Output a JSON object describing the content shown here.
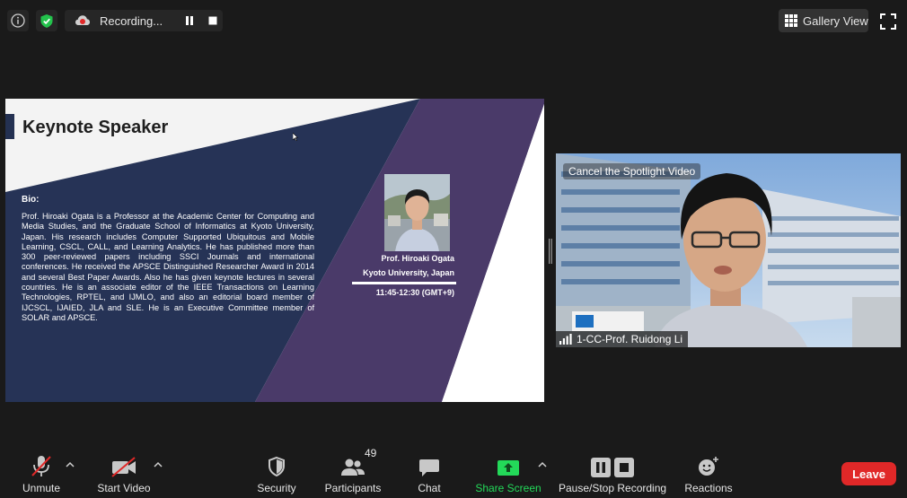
{
  "top_bar": {
    "info_icon": "info-icon",
    "security_icon": "shield-check-icon",
    "recording_label": "Recording...",
    "gallery_label": "Gallery View"
  },
  "slide": {
    "title": "Keynote Speaker",
    "bio_label": "Bio:",
    "bio_text": "Prof. Hiroaki Ogata is a Professor at the Academic Center for Computing and Media Studies, and the Graduate School of Informatics at Kyoto University, Japan. His research includes Computer Supported Ubiquitous and Mobile Learning, CSCL, CALL, and Learning Analytics. He has published more than 300 peer-reviewed papers including SSCI Journals and international conferences. He received the APSCE Distinguished Researcher Award in 2014 and several Best Paper Awards. Also he has given keynote lectures in several countries. He is an associate editor of the IEEE Transactions on Learning Technologies, RPTEL, and IJMLO, and also an editorial board member of IJCSCL, IJAIED, JLA and SLE. He is an Executive Committee member of SOLAR and APSCE.",
    "speaker_name": "Prof. Hiroaki Ogata",
    "speaker_affiliation": "Kyoto University, Japan",
    "session_time": "11:45-12:30 (GMT+9)",
    "colors": {
      "navy": "#243152",
      "purple": "#4b3a68",
      "background": "#f2f2f2"
    }
  },
  "video": {
    "cancel_spotlight_label": "Cancel the Spotlight Video",
    "participant_name": "1-CC-Prof. Ruidong Li"
  },
  "toolbar": {
    "unmute_label": "Unmute",
    "start_video_label": "Start Video",
    "security_label": "Security",
    "participants_label": "Participants",
    "participants_count": "49",
    "chat_label": "Chat",
    "share_screen_label": "Share Screen",
    "recording_label": "Pause/Stop Recording",
    "reactions_label": "Reactions",
    "leave_label": "Leave",
    "colors": {
      "share_green": "#23d959",
      "leave_red": "#e02828",
      "mute_slash": "#e02828"
    }
  }
}
